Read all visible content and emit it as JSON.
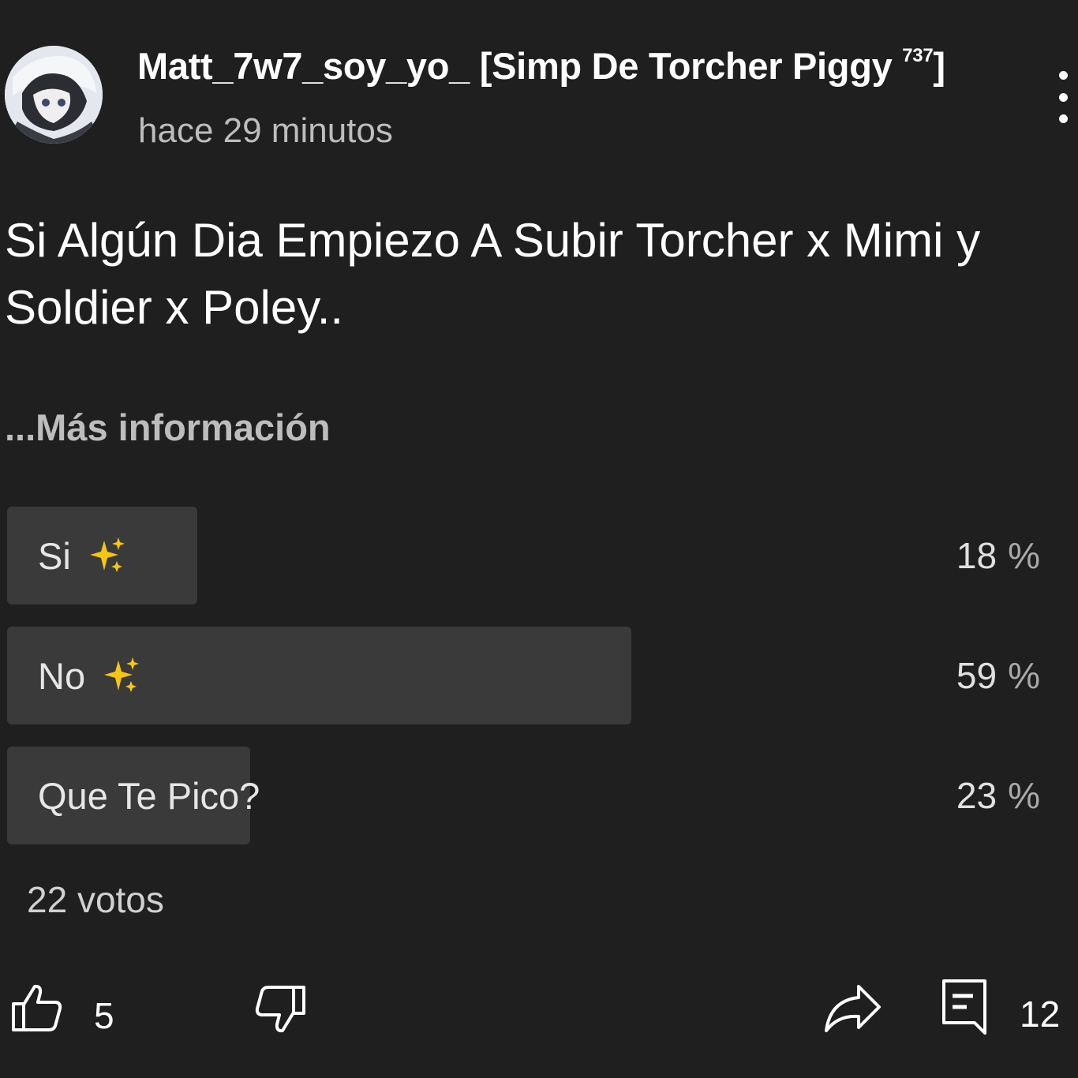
{
  "post": {
    "author": "Matt_7w7_soy_yo_ [Simp De Torcher Piggy",
    "author_sup": "737",
    "author_close": "]",
    "time": "hace 29 minutos",
    "title": "Si Algún Dia Empiezo A Subir Torcher x Mimi y Soldier x Poley..",
    "more_label": "...Más información"
  },
  "poll": {
    "options": [
      {
        "label": "Si",
        "icon": "sparkles-icon",
        "percent": 18,
        "percent_text": "18",
        "symbol": "%"
      },
      {
        "label": "No",
        "icon": "sparkles-icon",
        "percent": 59,
        "percent_text": "59",
        "symbol": "%"
      },
      {
        "label": "Que Te Pico?",
        "percent": 23,
        "percent_text": "23",
        "symbol": "%"
      }
    ],
    "votes": "22 votos"
  },
  "actions": {
    "like_icon": "thumbs-up-icon",
    "like_count": "5",
    "dislike_icon": "thumbs-down-icon",
    "share_icon": "share-icon",
    "comment_icon": "comment-icon",
    "comment_count": "12"
  },
  "colors": {
    "background": "#1f1f1f",
    "poll_bar": "#3a3a3a",
    "sparkle": "#f5c518"
  }
}
